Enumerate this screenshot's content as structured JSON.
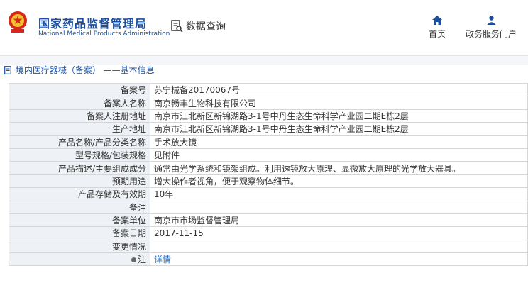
{
  "header": {
    "title": "国家药品监督管理局",
    "subtitle": "National Medical Products Administration",
    "query_label": "数据查询",
    "nav": [
      {
        "label": "首页",
        "icon": "home-icon"
      },
      {
        "label": "政务服务门户",
        "icon": "user-icon"
      }
    ]
  },
  "breadcrumb": {
    "text": "境内医疗器械（备案） ——基本信息"
  },
  "colors": {
    "brand": "#1a4fa0",
    "label_bg": "#eef1f5",
    "link": "#1a6bc8"
  },
  "record": {
    "rows": [
      {
        "label": "备案号",
        "value": "苏宁械备20170067号"
      },
      {
        "label": "备案人名称",
        "value": "南京畅丰生物科技有限公司"
      },
      {
        "label": "备案人注册地址",
        "value": "南京市江北新区新锦湖路3-1号中丹生态生命科学产业园二期E栋2层"
      },
      {
        "label": "生产地址",
        "value": "南京市江北新区新锦湖路3-1号中丹生态生命科学产业园二期E栋2层"
      },
      {
        "label": "产品名称/产品分类名称",
        "value": "手术放大镜"
      },
      {
        "label": "型号规格/包装规格",
        "value": "见附件"
      },
      {
        "label": "产品描述/主要组成成分",
        "value": "通常由光学系统和镜架组成。利用透镜放大原理、显微放大原理的光学放大器具。"
      },
      {
        "label": "预期用途",
        "value": "增大操作者视角，便于观察物体细节。"
      },
      {
        "label": "产品存储及有效期",
        "value": "10年"
      },
      {
        "label": "备注",
        "value": ""
      },
      {
        "label": "备案单位",
        "value": "南京市市场监督管理局"
      },
      {
        "label": "备案日期",
        "value": "2017-11-15"
      },
      {
        "label": "变更情况",
        "value": ""
      }
    ],
    "note_row": {
      "label": "注",
      "link_text": "详情"
    }
  }
}
